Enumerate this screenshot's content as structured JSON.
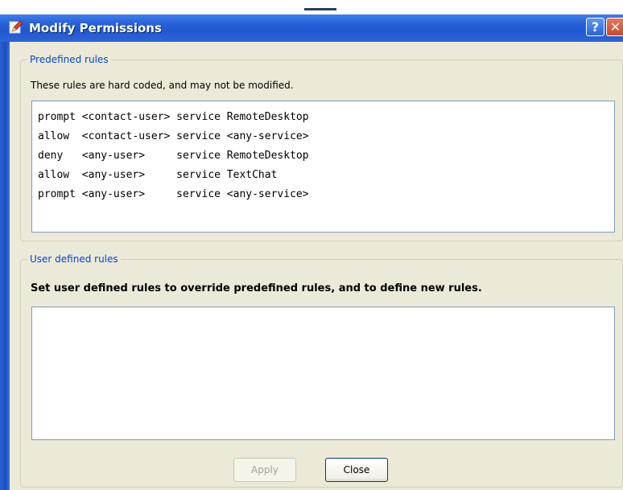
{
  "window": {
    "title": "Modify Permissions",
    "help_label": "?",
    "close_label": "✕"
  },
  "predefined": {
    "legend": "Predefined rules",
    "description": "These rules are hard coded, and may not be modified.",
    "rules": [
      "prompt <contact-user> service RemoteDesktop",
      "allow  <contact-user> service <any-service>",
      "deny   <any-user>     service RemoteDesktop",
      "allow  <any-user>     service TextChat",
      "prompt <any-user>     service <any-service>"
    ]
  },
  "user_defined": {
    "legend": "User defined rules",
    "description": "Set user defined rules to override predefined rules, and to define new rules.",
    "value": ""
  },
  "buttons": {
    "apply": "Apply",
    "close": "Close"
  },
  "colors": {
    "title_bar": "#2a63d8",
    "client_bg": "#ece9d8",
    "legend_text": "#0046d5",
    "close_button": "#c74a2a"
  }
}
